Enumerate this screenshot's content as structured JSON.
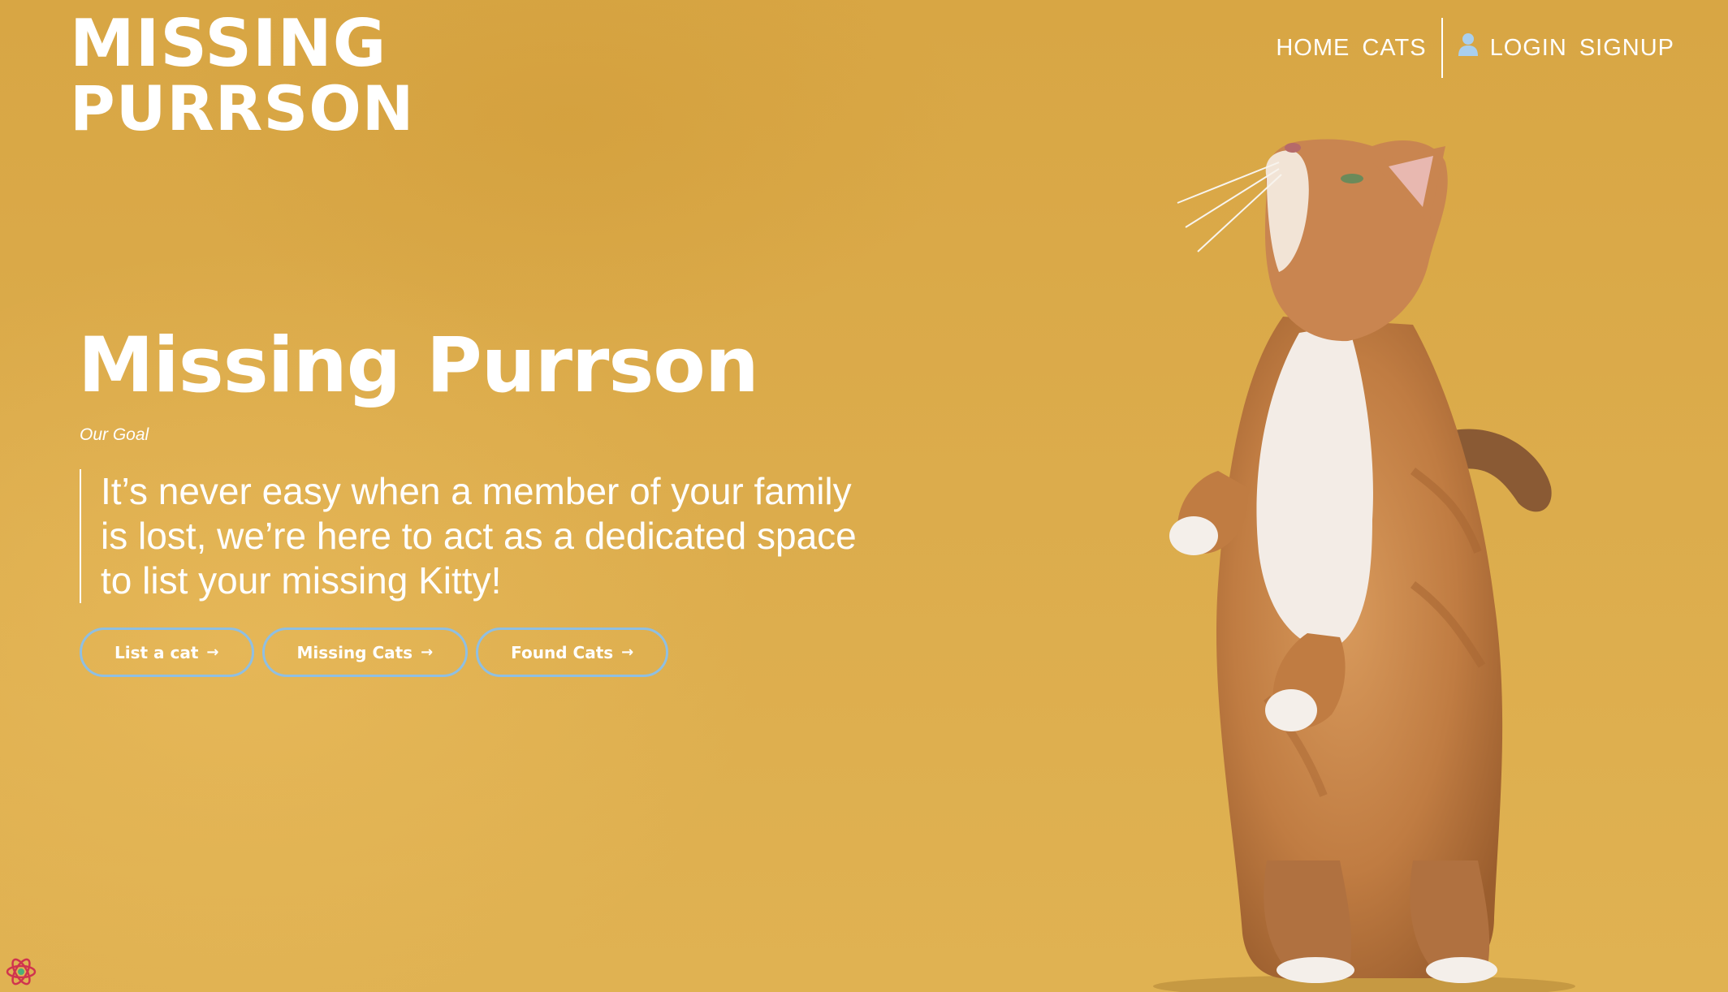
{
  "logo": {
    "line1": "MISSING",
    "line2": "PURRSON"
  },
  "nav": {
    "links": [
      "HOME",
      "CATS"
    ],
    "auth": [
      "LOGIN",
      "SIGNUP"
    ]
  },
  "hero": {
    "title": "Missing Purrson",
    "subtitle": "Our Goal",
    "quote": "It’s never easy when a member of your family is lost, we’re here to act as a dedicated space to list your missing Kitty!",
    "buttons": [
      {
        "label": "List a cat",
        "arrow": "→"
      },
      {
        "label": "Missing Cats",
        "arrow": "→"
      },
      {
        "label": "Found Cats",
        "arrow": "→"
      }
    ]
  },
  "icons": {
    "user": "user-icon",
    "devtools": "react-devtools-icon"
  },
  "colors": {
    "background": "#dcac4c",
    "button_border": "#8fbfe2",
    "user_icon": "#a9cfee",
    "text": "#ffffff"
  }
}
